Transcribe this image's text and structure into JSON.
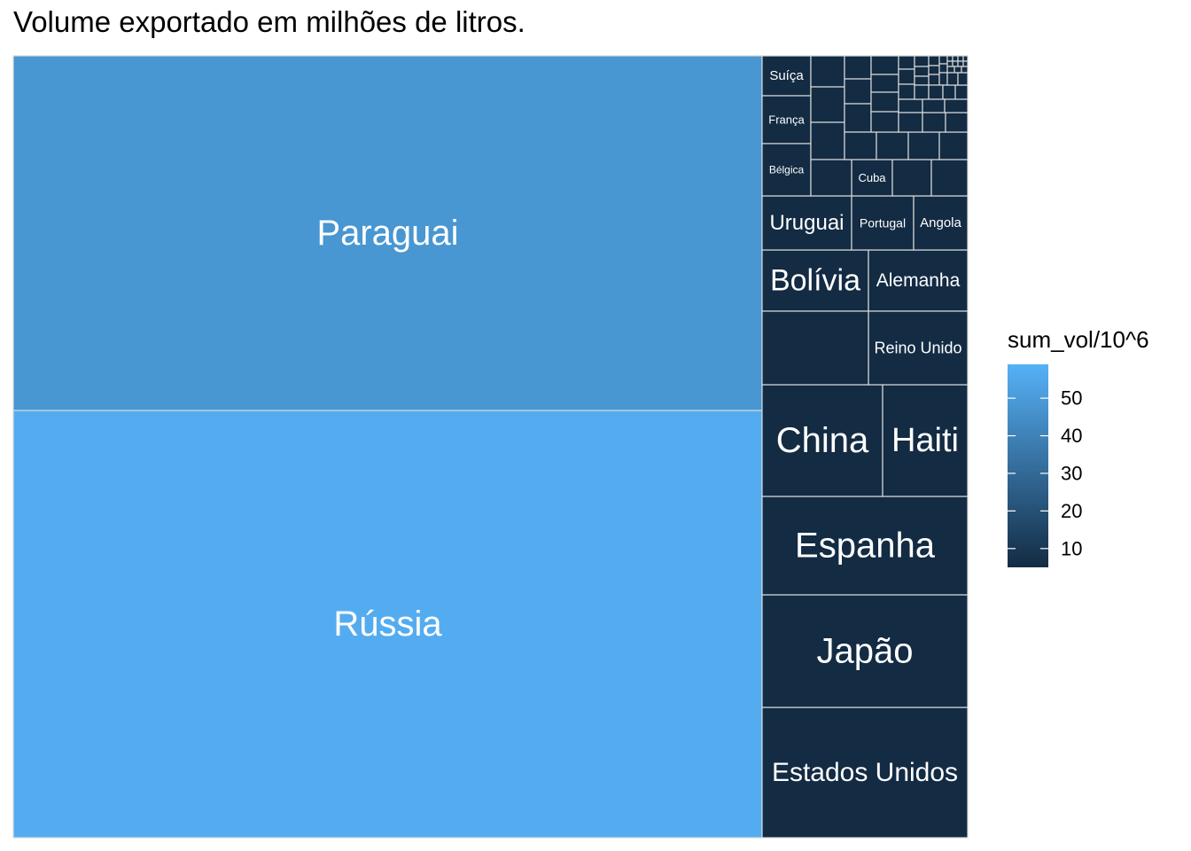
{
  "chart_data": {
    "type": "treemap",
    "title": "Volume exportado em milhões de litros.",
    "fill_variable": "sum_vol/10^6",
    "colorbar": {
      "title": "sum_vol/10^6",
      "ticks": [
        10,
        20,
        30,
        40,
        50
      ],
      "range": [
        5,
        59
      ],
      "low_color": "#132b43",
      "high_color": "#56b1f7"
    },
    "items": [
      {
        "label": "Rússia",
        "value": 57
      },
      {
        "label": "Paraguai",
        "value": 48
      },
      {
        "label": "Estados Unidos",
        "value": 4.7
      },
      {
        "label": "Japão",
        "value": 4.2
      },
      {
        "label": "Espanha",
        "value": 3.6
      },
      {
        "label": "China",
        "value": 2.2
      },
      {
        "label": "Haiti",
        "value": 1.7
      },
      {
        "label": "Bolívia",
        "value": 1.2
      },
      {
        "label": "Alemanha",
        "value": 1.2
      },
      {
        "label": "Reino Unido",
        "value": 1.4
      },
      {
        "label": "Uruguai",
        "value": 1.0
      },
      {
        "label": "Portugal",
        "value": 0.7
      },
      {
        "label": "Angola",
        "value": 0.6
      },
      {
        "label": "Suíça",
        "value": 0.4
      },
      {
        "label": "França",
        "value": 0.4
      },
      {
        "label": "Bélgica",
        "value": 0.4
      },
      {
        "label": "Cuba",
        "value": 0.25
      }
    ]
  }
}
